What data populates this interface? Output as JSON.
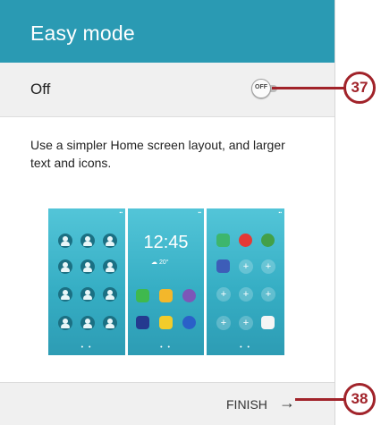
{
  "header": {
    "title": "Easy mode"
  },
  "toggle": {
    "label": "Off",
    "switch_text": "OFF",
    "state": "off"
  },
  "description": "Use a simpler Home screen layout, and larger text and icons.",
  "preview": {
    "clock_time": "12:45",
    "weather_text": "☁ 20°",
    "contact_grid": {
      "rows": 4,
      "cols": 3,
      "icon": "contact-icon"
    },
    "home_apps": [
      "phone-icon",
      "message-icon",
      "internet-icon",
      "camera-icon",
      "gallery-icon",
      "music-icon"
    ],
    "apps_panel": [
      "messages-app-icon",
      "record-app-icon",
      "maps-app-icon",
      "settings-app-icon",
      "add-icon",
      "add-icon",
      "add-icon",
      "add-icon",
      "add-icon",
      "add-icon",
      "add-icon",
      "apps-grid-icon"
    ],
    "page_indicator": "• •"
  },
  "footer": {
    "finish_label": "FINISH",
    "arrow_icon": "arrow-right-icon"
  },
  "callouts": [
    {
      "number": "37"
    },
    {
      "number": "38"
    }
  ],
  "colors": {
    "header": "#2a9ab3",
    "callout": "#a1232a",
    "background": "#f0f0f0"
  }
}
